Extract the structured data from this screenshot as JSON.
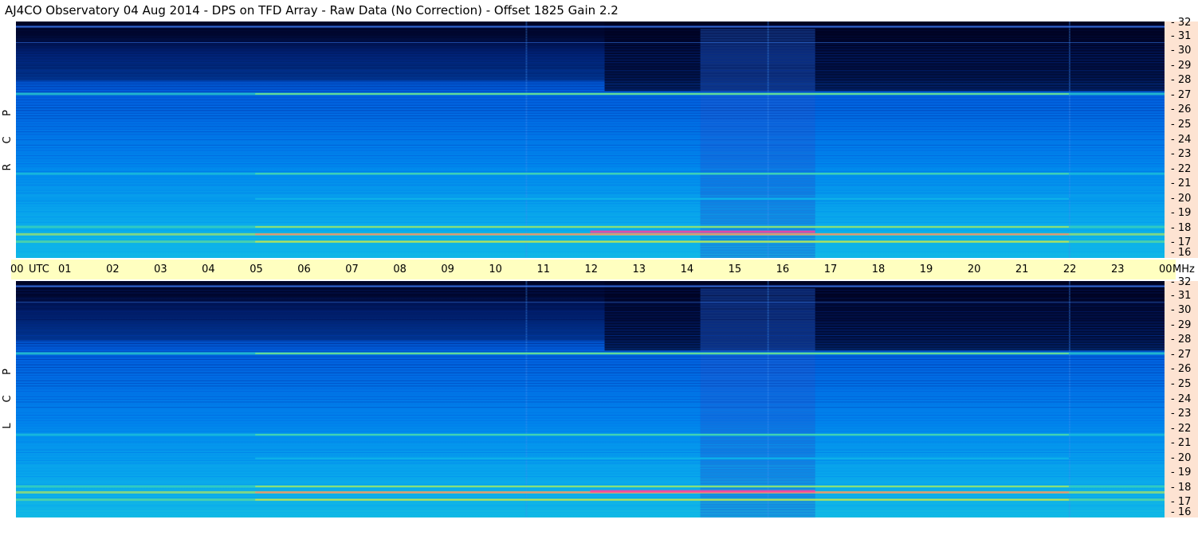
{
  "title": "AJ4CO Observatory  04 Aug 2014  -  DPS on TFD Array  -  Raw Data (No Correction)  -  Offset 1825  Gain 2.2",
  "panels": [
    {
      "name": "rcp",
      "letters": [
        "R",
        "C",
        "P"
      ]
    },
    {
      "name": "lcp",
      "letters": [
        "L",
        "C",
        "P"
      ]
    }
  ],
  "colors": {
    "background": "#ffffff",
    "time_axis_bg": "#ffffc0",
    "freq_axis_bg": "#fde3d2",
    "colormap": [
      "#000018",
      "#00104a",
      "#0030a0",
      "#0060e0",
      "#0090f0",
      "#10b8e8",
      "#30d0c0",
      "#80e080",
      "#e0e040",
      "#ff40a0"
    ]
  },
  "chart_data": [
    {
      "type": "heatmap",
      "panel": "RCP",
      "x": [
        "00",
        "01",
        "02",
        "03",
        "04",
        "05",
        "06",
        "07",
        "08",
        "09",
        "10",
        "11",
        "12",
        "13",
        "14",
        "15",
        "16",
        "17",
        "18",
        "19",
        "20",
        "21",
        "22",
        "23",
        "00"
      ],
      "x_unit": "UTC",
      "y": [
        32,
        31,
        30,
        29,
        28,
        27,
        26,
        25,
        24,
        23,
        22,
        21,
        20,
        19,
        18,
        17,
        16
      ],
      "y_unit": "MHz",
      "ylim": [
        16,
        32
      ],
      "xlim": [
        0,
        24
      ],
      "bright_bands": [
        {
          "freq": 17.1,
          "intensity": 0.85
        },
        {
          "freq": 17.6,
          "intensity": 0.95
        },
        {
          "freq": 18.1,
          "intensity": 0.8
        },
        {
          "freq": 20.0,
          "intensity": 0.55
        },
        {
          "freq": 21.7,
          "intensity": 0.7
        },
        {
          "freq": 27.1,
          "intensity": 0.75
        }
      ]
    },
    {
      "type": "heatmap",
      "panel": "LCP",
      "x": [
        "00",
        "01",
        "02",
        "03",
        "04",
        "05",
        "06",
        "07",
        "08",
        "09",
        "10",
        "11",
        "12",
        "13",
        "14",
        "15",
        "16",
        "17",
        "18",
        "19",
        "20",
        "21",
        "22",
        "23",
        "00"
      ],
      "x_unit": "UTC",
      "y": [
        32,
        31,
        30,
        29,
        28,
        27,
        26,
        25,
        24,
        23,
        22,
        21,
        20,
        19,
        18,
        17,
        16
      ],
      "y_unit": "MHz",
      "ylim": [
        16,
        32
      ],
      "xlim": [
        0,
        24
      ],
      "bright_bands": [
        {
          "freq": 17.2,
          "intensity": 0.85
        },
        {
          "freq": 17.7,
          "intensity": 0.95
        },
        {
          "freq": 18.1,
          "intensity": 0.8
        },
        {
          "freq": 20.0,
          "intensity": 0.55
        },
        {
          "freq": 21.6,
          "intensity": 0.7
        },
        {
          "freq": 27.1,
          "intensity": 0.75
        }
      ]
    }
  ]
}
